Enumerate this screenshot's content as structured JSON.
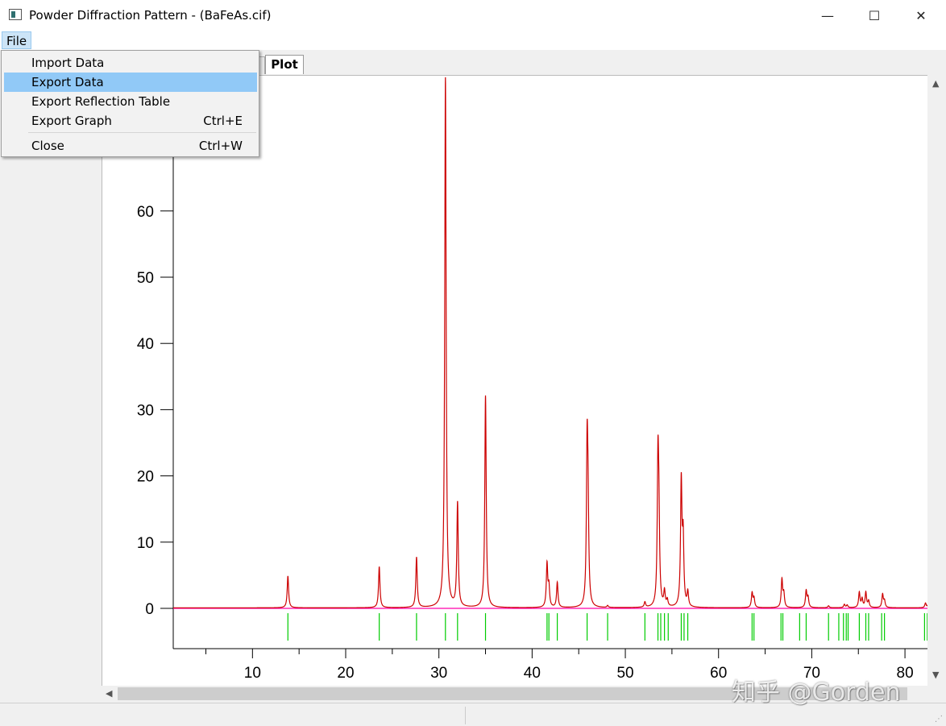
{
  "window": {
    "title": "Powder Diffraction Pattern - (BaFeAs.cif)",
    "minimize_glyph": "—",
    "maximize_glyph": "☐",
    "close_glyph": "✕"
  },
  "menubar": {
    "file_label": "File"
  },
  "file_menu": {
    "items": [
      {
        "label": "Import Data",
        "shortcut": ""
      },
      {
        "label": "Export Data",
        "shortcut": "",
        "highlighted": true
      },
      {
        "label": "Export Reflection Table",
        "shortcut": ""
      },
      {
        "label": "Export Graph",
        "shortcut": "Ctrl+E"
      },
      {
        "label": "Close",
        "shortcut": "Ctrl+W"
      }
    ]
  },
  "tabs": {
    "active_label": "Plot"
  },
  "watermark": {
    "text": "知乎 @Gorden"
  },
  "colors": {
    "pattern": "#cc0000",
    "reflections": "#00cc00",
    "baseline": "#ff00aa",
    "menu_highlight": "#91c9f7"
  },
  "chart_data": {
    "type": "line",
    "xlabel": "",
    "ylabel": "",
    "x_ticks": [
      10,
      20,
      30,
      40,
      50,
      60,
      70,
      80
    ],
    "y_ticks": [
      0,
      10,
      20,
      30,
      40,
      50,
      60
    ],
    "xlim": [
      1.5,
      82.5
    ],
    "ylim": [
      -6,
      80
    ],
    "grid": false,
    "series": [
      {
        "peaks": [
          {
            "x": 13.8,
            "y": 4.8
          },
          {
            "x": 23.6,
            "y": 6.2
          },
          {
            "x": 27.6,
            "y": 7.6
          },
          {
            "x": 30.7,
            "y": 80
          },
          {
            "x": 32.0,
            "y": 15.7
          },
          {
            "x": 35.0,
            "y": 32.0
          },
          {
            "x": 41.6,
            "y": 6.5
          },
          {
            "x": 41.8,
            "y": 3.0
          },
          {
            "x": 42.7,
            "y": 3.8
          },
          {
            "x": 45.9,
            "y": 22.8
          },
          {
            "x": 46.0,
            "y": 12.0
          },
          {
            "x": 48.1,
            "y": 0.3
          },
          {
            "x": 52.1,
            "y": 0.8
          },
          {
            "x": 53.5,
            "y": 20.8
          },
          {
            "x": 53.6,
            "y": 11.0
          },
          {
            "x": 54.2,
            "y": 2.3
          },
          {
            "x": 54.5,
            "y": 1.0
          },
          {
            "x": 56.0,
            "y": 18.7
          },
          {
            "x": 56.2,
            "y": 10.0
          },
          {
            "x": 56.7,
            "y": 2.2
          },
          {
            "x": 63.6,
            "y": 2.2
          },
          {
            "x": 63.8,
            "y": 1.4
          },
          {
            "x": 66.8,
            "y": 4.2
          },
          {
            "x": 67.0,
            "y": 2.0
          },
          {
            "x": 69.4,
            "y": 2.5
          },
          {
            "x": 69.6,
            "y": 1.5
          },
          {
            "x": 71.8,
            "y": 0.3
          },
          {
            "x": 73.5,
            "y": 0.5
          },
          {
            "x": 73.8,
            "y": 0.4
          },
          {
            "x": 75.1,
            "y": 2.3
          },
          {
            "x": 75.4,
            "y": 1.3
          },
          {
            "x": 75.8,
            "y": 2.3
          },
          {
            "x": 76.1,
            "y": 1.0
          },
          {
            "x": 77.6,
            "y": 2.0
          },
          {
            "x": 77.8,
            "y": 1.0
          },
          {
            "x": 82.2,
            "y": 0.7
          },
          {
            "x": 82.5,
            "y": 0.5
          }
        ]
      }
    ],
    "reflections": [
      13.8,
      23.6,
      27.6,
      30.7,
      32.0,
      35.0,
      41.6,
      41.8,
      42.7,
      45.9,
      48.1,
      52.1,
      53.5,
      53.8,
      54.2,
      54.6,
      56.0,
      56.3,
      56.7,
      63.6,
      63.8,
      66.7,
      66.9,
      68.7,
      69.4,
      71.8,
      72.9,
      73.4,
      73.7,
      73.9,
      75.1,
      75.8,
      76.1,
      77.5,
      77.8,
      82.1,
      82.4
    ]
  }
}
